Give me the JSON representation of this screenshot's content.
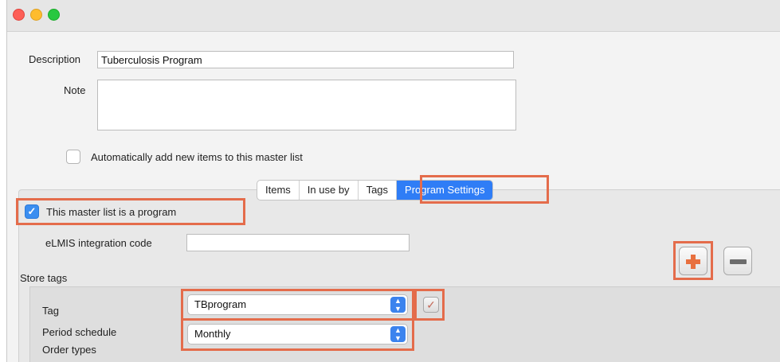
{
  "form": {
    "description_label": "Description",
    "description_value": "Tuberculosis Program",
    "note_label": "Note",
    "note_value": "",
    "auto_add_label": "Automatically add new items to this master list"
  },
  "tabs": [
    {
      "label": "Items"
    },
    {
      "label": "In use by"
    },
    {
      "label": "Tags"
    },
    {
      "label": "Program Settings",
      "active": true
    }
  ],
  "program": {
    "is_program_label": "This master list is a program",
    "is_program_checked": true,
    "elmis_label": "eLMIS integration code",
    "elmis_value": "",
    "store_tags_label": "Store tags",
    "tag_label": "Tag",
    "tag_value": "TBprogram",
    "period_schedule_label": "Period schedule",
    "period_schedule_value": "Monthly",
    "order_types_label": "Order types"
  },
  "icons": {
    "add": "plus-icon",
    "remove": "minus-icon",
    "confirm": "checkmark-icon",
    "select_arrows": "up-down-arrows-icon"
  },
  "colors": {
    "highlight": "#e46c4b",
    "accent": "#2f7df6",
    "add_icon": "#e8703f"
  }
}
